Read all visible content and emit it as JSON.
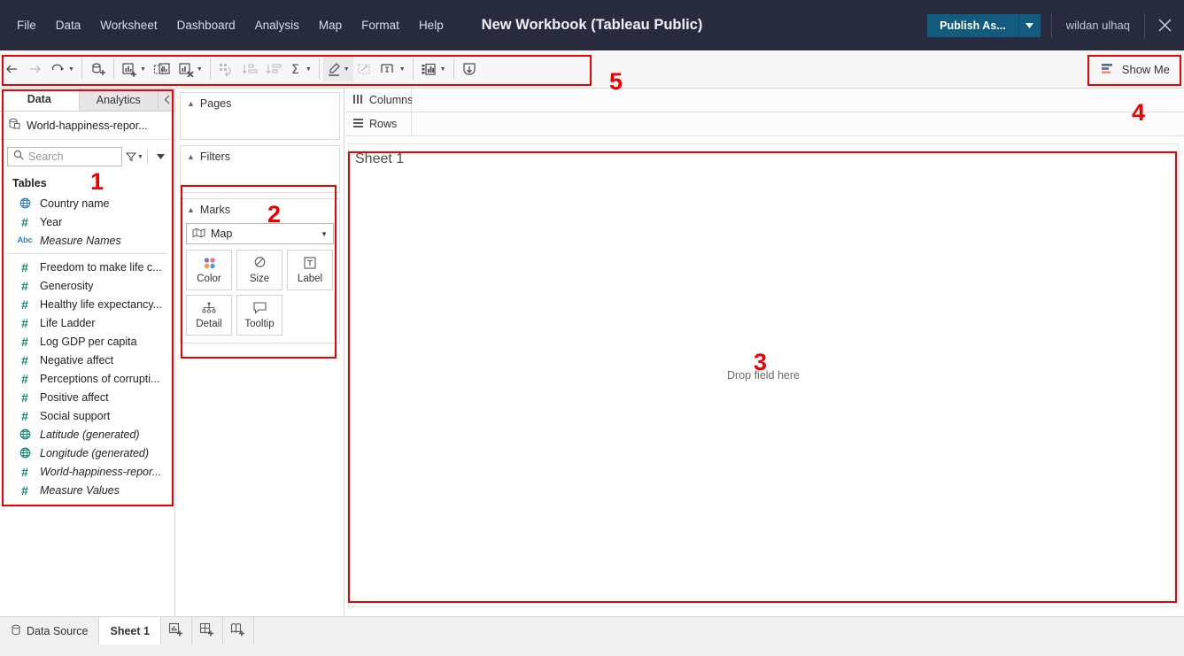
{
  "titlebar": {
    "menu": [
      "File",
      "Data",
      "Worksheet",
      "Dashboard",
      "Analysis",
      "Map",
      "Format",
      "Help"
    ],
    "title": "New Workbook (Tableau Public)",
    "publish_label": "Publish As...",
    "username": "wildan ulhaq",
    "close_icon": "close-icon",
    "accent_color": "#125b7f",
    "bar_color": "#282b3e"
  },
  "toolbar": {
    "buttons": [
      {
        "name": "back-icon",
        "tip": "Back"
      },
      {
        "name": "forward-icon",
        "tip": "Forward"
      },
      {
        "name": "undo-redo-icon",
        "tip": "Undo"
      },
      {
        "name": "new-data-source-icon",
        "tip": "New Data Source"
      },
      {
        "name": "new-worksheet-icon",
        "tip": "New Worksheet"
      },
      {
        "name": "duplicate-sheet-icon",
        "tip": "Duplicate Sheet"
      },
      {
        "name": "clear-sheet-icon",
        "tip": "Clear Sheet"
      },
      {
        "name": "swap-rows-columns-icon",
        "tip": "Swap Rows and Columns"
      },
      {
        "name": "sort-ascending-icon",
        "tip": "Sort Ascending"
      },
      {
        "name": "sort-descending-icon",
        "tip": "Sort Descending"
      },
      {
        "name": "totals-icon",
        "tip": "Totals"
      },
      {
        "name": "highlight-icon",
        "tip": "Highlight"
      },
      {
        "name": "presentation-mode-icon",
        "tip": "Presentation Mode"
      },
      {
        "name": "fit-icon",
        "tip": "Fit"
      },
      {
        "name": "show-hide-cards-icon",
        "tip": "Show/Hide Cards"
      },
      {
        "name": "show-me-download-icon",
        "tip": "Download"
      }
    ],
    "show_me_label": "Show Me"
  },
  "datapane": {
    "tabs": [
      {
        "label": "Data",
        "selected": true
      },
      {
        "label": "Analytics",
        "selected": false
      }
    ],
    "collapse_icon": "chevron-left-icon",
    "datasource": {
      "name": "World-happiness-repor...",
      "icon": "database-icon"
    },
    "search": {
      "placeholder": "Search",
      "icon": "search-icon",
      "filter_icon": "filter-icon",
      "more_icon": "chevron-down-icon"
    },
    "section_header": "Tables",
    "fields": [
      {
        "label": "Country name",
        "type": "geo-blue",
        "italic": false
      },
      {
        "label": "Year",
        "type": "num",
        "italic": false
      },
      {
        "label": "Measure Names",
        "type": "abc",
        "italic": true,
        "divider_after": true
      },
      {
        "label": "Freedom to make life c...",
        "type": "num",
        "italic": false
      },
      {
        "label": "Generosity",
        "type": "num",
        "italic": false
      },
      {
        "label": "Healthy life expectancy...",
        "type": "num",
        "italic": false
      },
      {
        "label": "Life Ladder",
        "type": "num",
        "italic": false
      },
      {
        "label": "Log GDP per capita",
        "type": "num",
        "italic": false
      },
      {
        "label": "Negative affect",
        "type": "num",
        "italic": false
      },
      {
        "label": "Perceptions of corrupti...",
        "type": "num",
        "italic": false
      },
      {
        "label": "Positive affect",
        "type": "num",
        "italic": false
      },
      {
        "label": "Social support",
        "type": "num",
        "italic": false
      },
      {
        "label": "Latitude (generated)",
        "type": "geo",
        "italic": true
      },
      {
        "label": "Longitude (generated)",
        "type": "geo",
        "italic": true
      },
      {
        "label": "World-happiness-repor...",
        "type": "num",
        "italic": true
      },
      {
        "label": "Measure Values",
        "type": "num",
        "italic": true
      }
    ]
  },
  "shelves": {
    "pages_label": "Pages",
    "filters_label": "Filters",
    "marks_label": "Marks",
    "marks_type": {
      "label": "Map",
      "icon": "map-mark-icon"
    },
    "mark_buttons": [
      {
        "label": "Color",
        "icon": "color-icon"
      },
      {
        "label": "Size",
        "icon": "size-icon"
      },
      {
        "label": "Label",
        "icon": "label-icon"
      },
      {
        "label": "Detail",
        "icon": "detail-icon"
      },
      {
        "label": "Tooltip",
        "icon": "tooltip-icon"
      }
    ]
  },
  "worksheet": {
    "columns_label": "Columns",
    "columns_icon": "columns-icon",
    "columns_value": "",
    "rows_label": "Rows",
    "rows_icon": "rows-icon",
    "rows_value": "",
    "sheet_title": "Sheet 1",
    "drop_hint": "Drop field here"
  },
  "statusbar": {
    "tabs": [
      {
        "label": "Data Source",
        "icon": "database-icon",
        "selected": false,
        "icon_only": false
      },
      {
        "label": "Sheet 1",
        "icon": "",
        "selected": true,
        "icon_only": false
      },
      {
        "label": "",
        "icon": "new-worksheet-icon",
        "selected": false,
        "icon_only": true
      },
      {
        "label": "",
        "icon": "new-dashboard-icon",
        "selected": false,
        "icon_only": true
      },
      {
        "label": "",
        "icon": "new-story-icon",
        "selected": false,
        "icon_only": true
      }
    ]
  },
  "annotations": {
    "color": "#ee0000",
    "numbers": [
      {
        "value": "1",
        "desc": "data-pane-annotation"
      },
      {
        "value": "2",
        "desc": "marks-card-annotation"
      },
      {
        "value": "3",
        "desc": "worksheet-canvas-annotation"
      },
      {
        "value": "4",
        "desc": "show-me-annotation"
      },
      {
        "value": "5",
        "desc": "toolbar-annotation"
      }
    ]
  }
}
